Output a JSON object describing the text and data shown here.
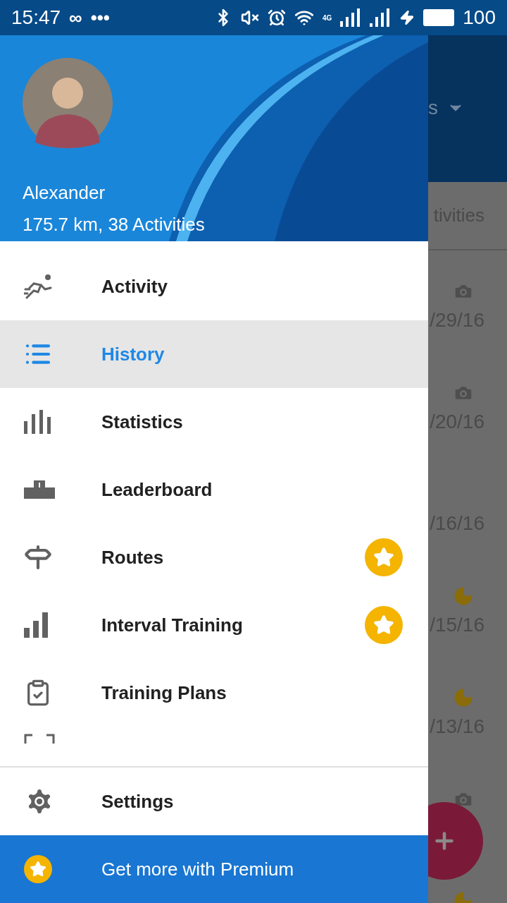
{
  "status_bar": {
    "time": "15:47",
    "left_glyphs": [
      "∞",
      "•••"
    ],
    "network_label": "4G",
    "battery": "100"
  },
  "profile": {
    "name": "Alexander",
    "summary": "175.7 km, 38 Activities"
  },
  "menu": [
    {
      "kind": "activity",
      "label": "Activity",
      "selected": false,
      "premium": false
    },
    {
      "kind": "history",
      "label": "History",
      "selected": true,
      "premium": false
    },
    {
      "kind": "statistics",
      "label": "Statistics",
      "selected": false,
      "premium": false
    },
    {
      "kind": "leaderboard",
      "label": "Leaderboard",
      "selected": false,
      "premium": false
    },
    {
      "kind": "routes",
      "label": "Routes",
      "selected": false,
      "premium": true
    },
    {
      "kind": "intervals",
      "label": "Interval Training",
      "selected": false,
      "premium": true
    },
    {
      "kind": "plans",
      "label": "Training Plans",
      "selected": false,
      "premium": false
    }
  ],
  "footer": [
    {
      "kind": "settings",
      "label": "Settings"
    },
    {
      "kind": "premium",
      "label": "Get more with Premium"
    }
  ],
  "background": {
    "title_fragment": "s",
    "tab_fragment": "tivities",
    "rows": [
      {
        "kind": "camera",
        "date": "/29/16"
      },
      {
        "kind": "camera",
        "date": "/20/16"
      },
      {
        "kind": "plain",
        "date": "/16/16"
      },
      {
        "kind": "moon",
        "date": "/15/16"
      },
      {
        "kind": "moon",
        "date": "/13/16"
      },
      {
        "kind": "camera"
      },
      {
        "kind": "moon"
      }
    ]
  }
}
